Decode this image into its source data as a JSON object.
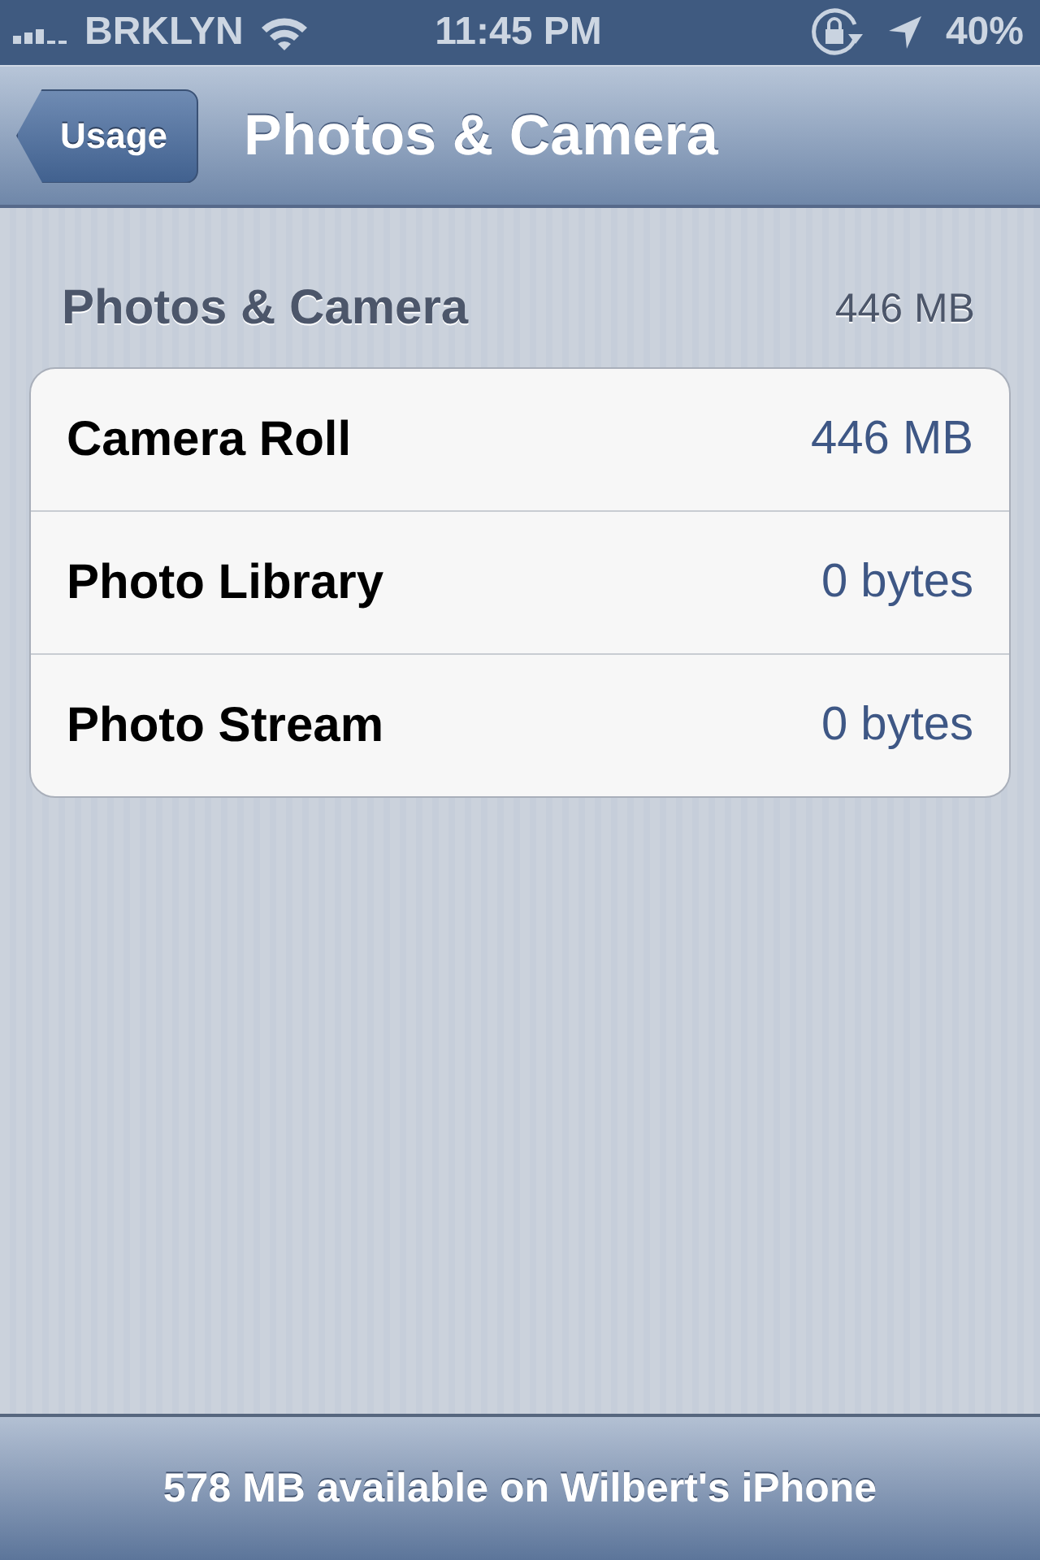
{
  "status_bar": {
    "carrier": "BRKLYN",
    "time": "11:45 PM",
    "battery": "40%"
  },
  "nav_bar": {
    "back_button": "Usage",
    "title": "Photos & Camera"
  },
  "section": {
    "title": "Photos & Camera",
    "total": "446 MB"
  },
  "rows": [
    {
      "label": "Camera Roll",
      "value": "446 MB"
    },
    {
      "label": "Photo Library",
      "value": "0 bytes"
    },
    {
      "label": "Photo Stream",
      "value": "0 bytes"
    }
  ],
  "footer": {
    "text": "578 MB available on Wilbert's iPhone"
  }
}
